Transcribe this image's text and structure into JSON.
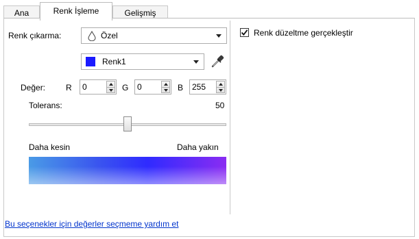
{
  "tabs": [
    {
      "label": "Ana"
    },
    {
      "label": "Renk İşleme"
    },
    {
      "label": "Gelişmiş"
    }
  ],
  "color_drop": {
    "label": "Renk çıkarma:",
    "selected": "Özel",
    "color_selected": "Renk1",
    "swatch_color": "#1a1aff"
  },
  "value": {
    "label": "Değer:",
    "r_label": "R",
    "r_value": "0",
    "g_label": "G",
    "g_value": "0",
    "b_label": "B",
    "b_value": "255"
  },
  "tolerance": {
    "label": "Tolerans:",
    "value": "50",
    "slider_fraction": 0.5,
    "left_label": "Daha kesin",
    "right_label": "Daha yakın"
  },
  "color_correction": {
    "label": "Renk düzeltme gerçekleştir",
    "checked": true
  },
  "help_link": "Bu seçenekler için değerler seçmeme yardım et"
}
